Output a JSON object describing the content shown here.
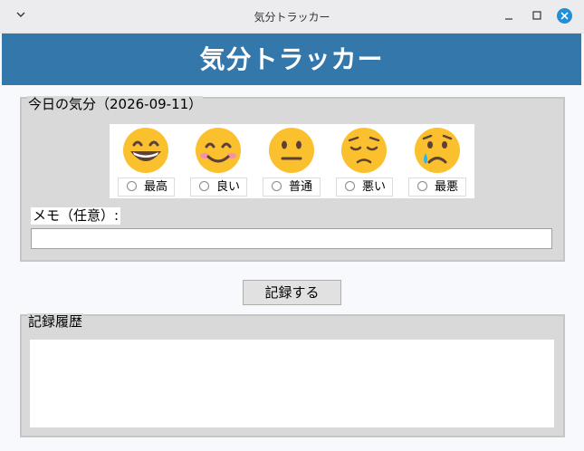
{
  "window": {
    "title": "気分トラッカー"
  },
  "header": {
    "title": "気分トラッカー"
  },
  "today": {
    "legend": "今日の気分（2026-09-11）",
    "moods": [
      {
        "emoji": "grinning-face-icon",
        "label": "最高",
        "selected": false
      },
      {
        "emoji": "smiling-face-icon",
        "label": "良い",
        "selected": false
      },
      {
        "emoji": "neutral-face-icon",
        "label": "普通",
        "selected": false
      },
      {
        "emoji": "pensive-face-icon",
        "label": "悪い",
        "selected": false
      },
      {
        "emoji": "crying-face-icon",
        "label": "最悪",
        "selected": false
      }
    ],
    "memo_label": "メモ（任意）:",
    "memo_value": ""
  },
  "actions": {
    "record_label": "記録する"
  },
  "history": {
    "legend": "記録履歴",
    "items": []
  },
  "colors": {
    "header_bg": "#3377ab",
    "panel_bg": "#d9d9d9",
    "close_button": "#1f8fdc",
    "emoji_face": "#fbc02d"
  }
}
